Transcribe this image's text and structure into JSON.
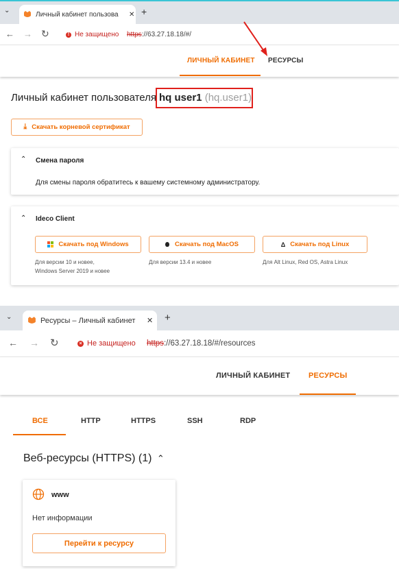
{
  "top": {
    "browser": {
      "tab_title": "Личный кабинет пользова",
      "security_label": "Не защищено",
      "url_proto": "https",
      "url_rest": "://63.27.18.18/#/"
    },
    "nav": {
      "cabinet": "ЛИЧНЫЙ КАБИНЕТ",
      "resources": "РЕСУРСЫ"
    },
    "heading": {
      "prefix": "Личный кабинет пользователя",
      "name": "hq user1",
      "login": "(hq.user1)"
    },
    "cert_button": "Скачать корневой сертификат",
    "password_panel": {
      "title": "Смена пароля",
      "body": "Для смены пароля обратитесь к вашему системному администратору."
    },
    "client_panel": {
      "title": "Ideco Client",
      "downloads": [
        {
          "label": "Скачать под Windows",
          "note1": "Для версии 10 и новее,",
          "note2": "Windows Server 2019 и новее"
        },
        {
          "label": "Скачать под MacOS",
          "note1": "Для версии 13.4 и новее",
          "note2": ""
        },
        {
          "label": "Скачать под Linux",
          "note1": "Для Alt Linux, Red OS, Astra Linux",
          "note2": ""
        }
      ]
    }
  },
  "bottom": {
    "browser": {
      "tab_title": "Ресурсы – Личный кабинет",
      "security_label": "Не защищено",
      "url_proto": "https",
      "url_rest": "://63.27.18.18/#/resources"
    },
    "nav": {
      "cabinet": "ЛИЧНЫЙ КАБИНЕТ",
      "resources": "РЕСУРСЫ"
    },
    "filters": [
      "ВСЕ",
      "HTTP",
      "HTTPS",
      "SSH",
      "RDP"
    ],
    "section_title": "Веб-ресурсы (HTTPS) (1)",
    "resource": {
      "name": "www",
      "info": "Нет информации",
      "button": "Перейти к ресурсу"
    }
  },
  "colors": {
    "accent": "#ef6c00",
    "annotation": "#e0201b",
    "insecure": "#c5221f"
  }
}
